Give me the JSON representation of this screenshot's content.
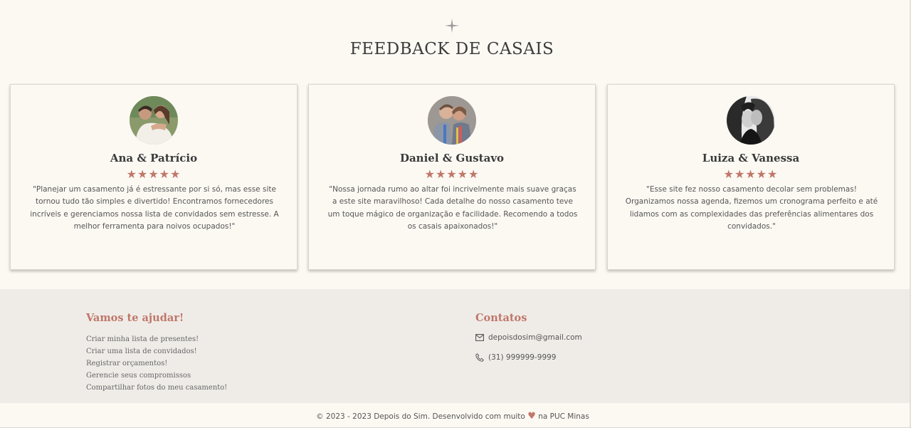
{
  "section": {
    "title": "FEEDBACK DE CASAIS",
    "icon": "sparkle-icon"
  },
  "colors": {
    "accent": "#c0776a",
    "background": "#fcf9f3",
    "footer_bg": "#efece8"
  },
  "testimonials": [
    {
      "names": "Ana & Patrício",
      "stars": "★★★★★",
      "rating": 5,
      "quote": "\"Planejar um casamento já é estressante por si só, mas esse site tornou tudo tão simples e divertido! Encontramos fornecedores incríveis e gerenciamos nossa lista de convidados sem estresse. A melhor ferramenta para noivos ocupados!\""
    },
    {
      "names": "Daniel & Gustavo",
      "stars": "★★★★★",
      "rating": 5,
      "quote": "\"Nossa jornada rumo ao altar foi incrivelmente mais suave graças a este site maravilhoso! Cada detalhe do nosso casamento teve um toque mágico de organização e facilidade. Recomendo a todos os casais apaixonados!\""
    },
    {
      "names": "Luiza & Vanessa",
      "stars": "★★★★★",
      "rating": 5,
      "quote": "\"Esse site fez nosso casamento decolar sem problemas! Organizamos nossa agenda, fizemos um cronograma perfeito e até lidamos com as complexidades das preferências alimentares dos convidados.\""
    }
  ],
  "footer": {
    "help_title": "Vamos te ajudar!",
    "help_links": [
      "Criar minha lista de presentes!",
      "Criar uma lista de convidados!",
      "Registrar orçamentos!",
      "Gerencie seus compromissos",
      "Compartilhar fotos do meu casamento!"
    ],
    "contacts_title": "Contatos",
    "email": "depoisdosim@gmail.com",
    "phone": "(31) 999999-9999",
    "copyright_prefix": "© 2023 - 2023 Depois do Sim. Desenvolvido com muito",
    "copyright_suffix": "na PUC Minas"
  }
}
